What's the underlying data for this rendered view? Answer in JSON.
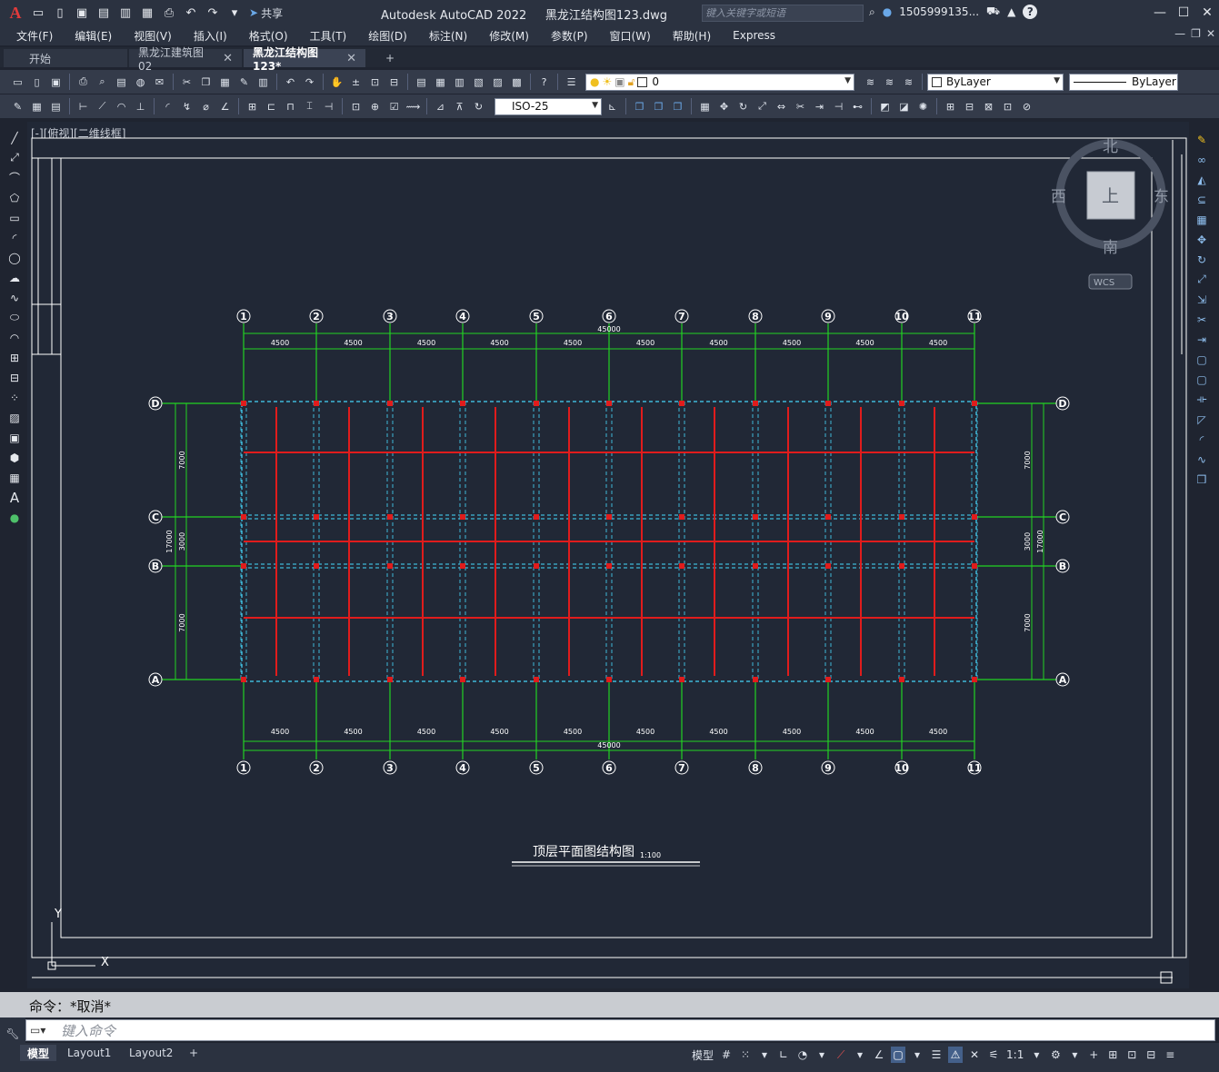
{
  "titlebar": {
    "share_label": "共享",
    "app_title": "Autodesk AutoCAD 2022",
    "file_name": "黑龙江结构图123.dwg",
    "search_placeholder": "键入关键字或短语",
    "user": "1505999135...",
    "help": "?"
  },
  "menu": [
    "文件(F)",
    "编辑(E)",
    "视图(V)",
    "插入(I)",
    "格式(O)",
    "工具(T)",
    "绘图(D)",
    "标注(N)",
    "修改(M)",
    "参数(P)",
    "窗口(W)",
    "帮助(H)",
    "Express"
  ],
  "tabs": [
    {
      "label": "开始"
    },
    {
      "label": "黑龙江建筑图02"
    },
    {
      "label": "黑龙江结构图123*"
    }
  ],
  "toolbar": {
    "layer_value": "0",
    "color_value": "ByLayer",
    "linetype_value": "ByLayer",
    "dimstyle_value": "ISO-25"
  },
  "viewport_label": "[-][俯视][二维线框]",
  "viewcube": {
    "north": "北",
    "south": "南",
    "east": "东",
    "west": "西",
    "face": "上",
    "wcs": "WCS"
  },
  "drawing": {
    "column_axes": [
      "1",
      "2",
      "3",
      "4",
      "5",
      "6",
      "7",
      "8",
      "9",
      "10",
      "11"
    ],
    "row_axes": [
      "D",
      "C",
      "B",
      "A"
    ],
    "bay_dimension": "4500",
    "total_dimension": "45000",
    "left_dims": [
      "7000",
      "3000",
      "7000"
    ],
    "total_vertical": "17000",
    "plan_title": "顶层平面图结构图",
    "plan_scale": "1:100",
    "ucs_x": "X",
    "ucs_y": "Y"
  },
  "command": {
    "history": "命令：*取消*",
    "placeholder": "键入命令"
  },
  "layouts": [
    {
      "label": "模型"
    },
    {
      "label": "Layout1"
    },
    {
      "label": "Layout2"
    }
  ],
  "status": {
    "model": "模型",
    "scale": "1:1"
  }
}
